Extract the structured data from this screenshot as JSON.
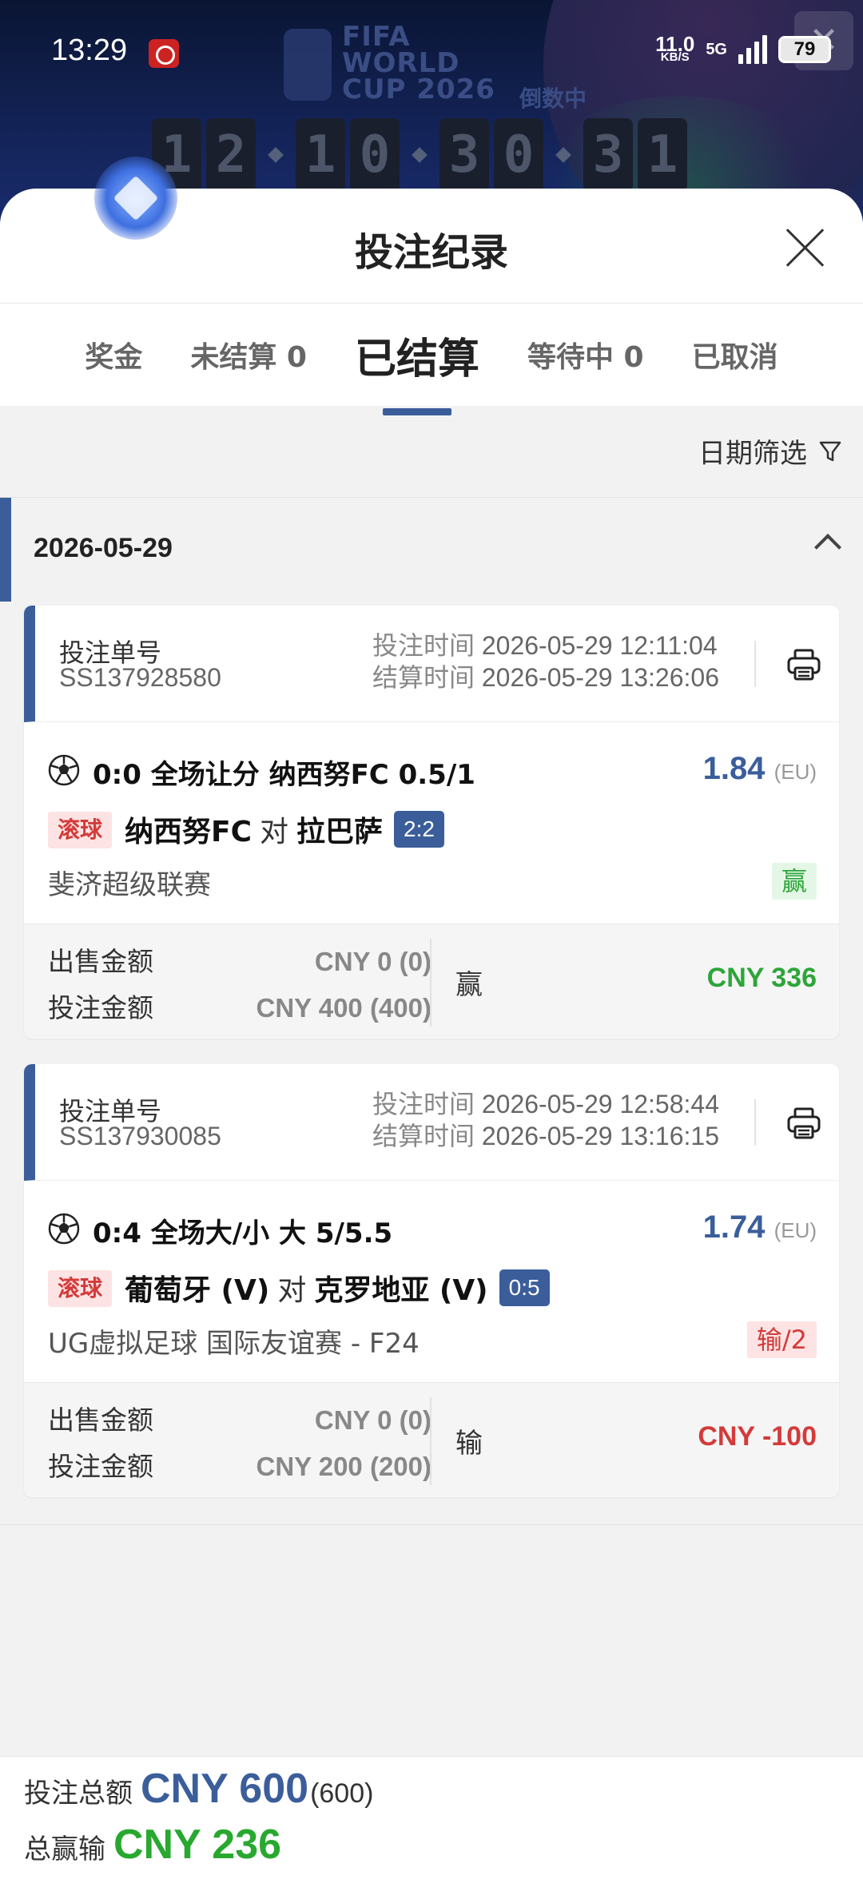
{
  "status_bar": {
    "time": "13:29",
    "net_speed": "11.0",
    "net_unit": "KB/S",
    "network": "5G",
    "battery": "79"
  },
  "banner": {
    "line1": "FIFA",
    "line2": "WORLD",
    "line3": "CUP 2026",
    "countdown_label": "倒数中",
    "countdown_digits": [
      "1",
      "2",
      "1",
      "0",
      "3",
      "0",
      "3",
      "1"
    ]
  },
  "sheet": {
    "title": "投注纪录"
  },
  "tabs": [
    {
      "label": "奖金"
    },
    {
      "label": "未结算 0"
    },
    {
      "label": "已结算"
    },
    {
      "label": "等待中 0"
    },
    {
      "label": "已取消"
    }
  ],
  "filter": {
    "label": "日期筛选"
  },
  "date_group": {
    "date": "2026-05-29"
  },
  "bets": [
    {
      "order_label": "投注单号",
      "order_no": "SS137928580",
      "bet_time_label": "投注时间",
      "bet_time": "2026-05-29 12:11:04",
      "settle_time_label": "结算时间",
      "settle_time": "2026-05-29 13:26:06",
      "title": "0:0 全场让分 纳西努FC 0.5/1",
      "odds": "1.84",
      "odds_unit": "(EU)",
      "live_tag": "滚球",
      "home": "纳西努FC",
      "vs": "对",
      "away": "拉巴萨",
      "score": "2:2",
      "league": "斐济超级联赛",
      "result_tag": "赢",
      "sell_label": "出售金额",
      "sell_value": "CNY 0 (0)",
      "stake_label": "投注金额",
      "stake_value": "CNY 400 (400)",
      "state": "赢",
      "payout": "CNY 336"
    },
    {
      "order_label": "投注单号",
      "order_no": "SS137930085",
      "bet_time_label": "投注时间",
      "bet_time": "2026-05-29 12:58:44",
      "settle_time_label": "结算时间",
      "settle_time": "2026-05-29 13:16:15",
      "title": "0:4 全场大/小 大 5/5.5",
      "odds": "1.74",
      "odds_unit": "(EU)",
      "live_tag": "滚球",
      "home": "葡萄牙 (V)",
      "vs": "对",
      "away": "克罗地亚 (V)",
      "score": "0:5",
      "league": "UG虚拟足球 国际友谊赛 - F24",
      "result_tag": "输/2",
      "sell_label": "出售金额",
      "sell_value": "CNY 0 (0)",
      "stake_label": "投注金额",
      "stake_value": "CNY 200 (200)",
      "state": "输",
      "payout": "CNY -100"
    }
  ],
  "summary": {
    "total_stake_label": "投注总额",
    "total_stake": "CNY 600",
    "total_stake_paren": "(600)",
    "total_win_label": "总赢输",
    "total_win": "CNY 236"
  },
  "colors": {
    "accent": "#3b5e9b",
    "win": "#2da53a",
    "lose": "#d43a3a"
  }
}
